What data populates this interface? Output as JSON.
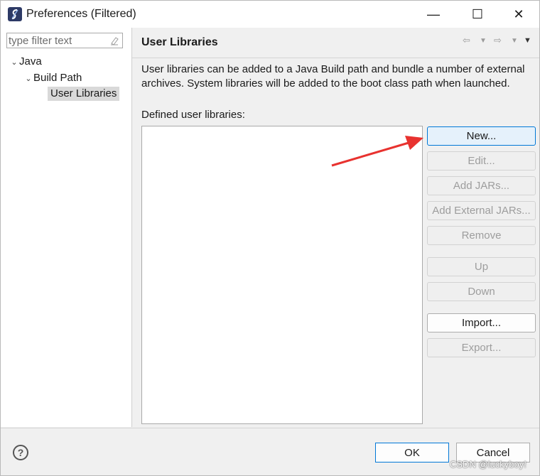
{
  "window": {
    "title": "Preferences (Filtered)",
    "controls": {
      "minimize": "—",
      "maximize": "☐",
      "close": "✕"
    }
  },
  "sidebar": {
    "filter_placeholder": "type filter text",
    "tree": [
      {
        "label": "Java",
        "expanded": true
      },
      {
        "label": "Build Path",
        "expanded": true
      },
      {
        "label": "User Libraries",
        "selected": true
      }
    ]
  },
  "main": {
    "title": "User Libraries",
    "description": "User libraries can be added to a Java Build path and bundle a number of external archives. System libraries will be added to the boot class path when launched.",
    "list_label": "Defined user libraries:",
    "buttons": {
      "new": "New...",
      "edit": "Edit...",
      "add_jars": "Add JARs...",
      "add_external_jars": "Add External JARs...",
      "remove": "Remove",
      "up": "Up",
      "down": "Down",
      "import": "Import...",
      "export": "Export..."
    }
  },
  "footer": {
    "ok": "OK",
    "cancel": "Cancel"
  },
  "watermark": "CSDN @luckyboy!",
  "colors": {
    "annotation_arrow": "#e8322f",
    "primary_border": "#0078d7"
  }
}
